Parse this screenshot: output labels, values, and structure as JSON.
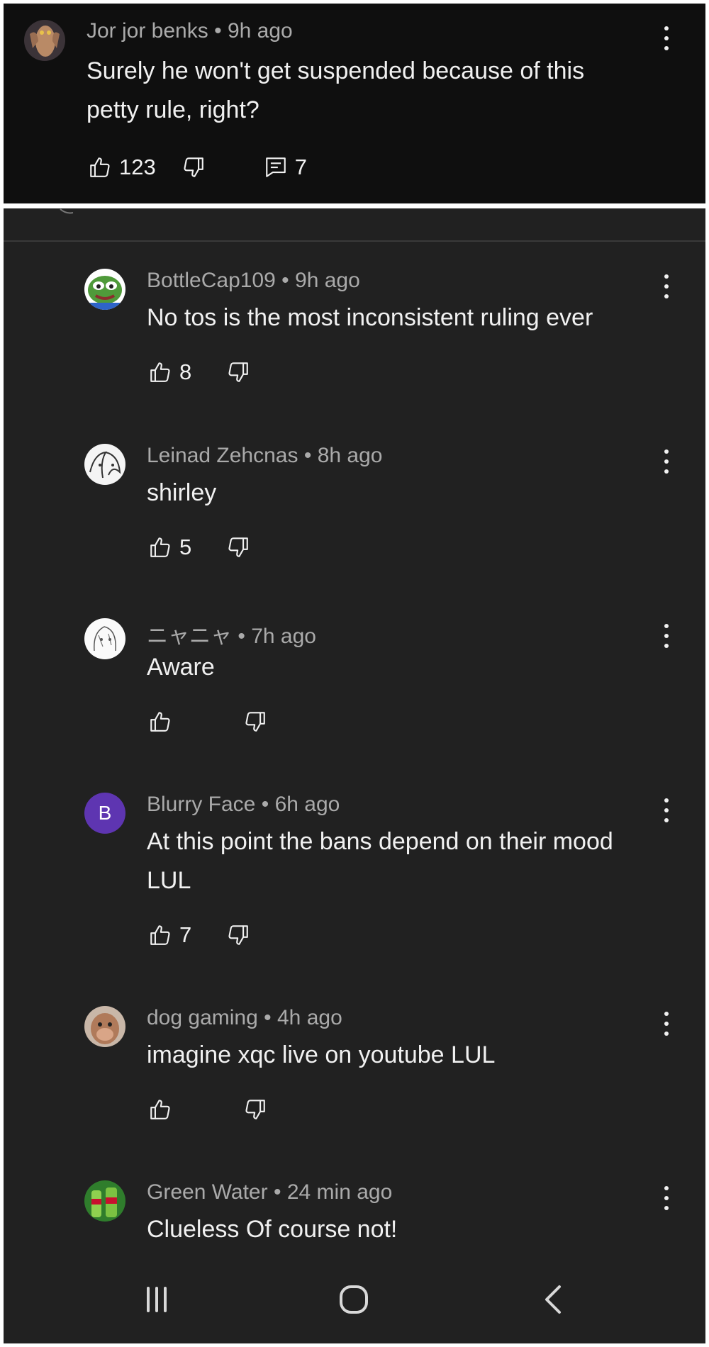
{
  "comments": [
    {
      "author": "Jor jor benks",
      "time": "9h ago",
      "text_lines": [
        "Surely he won't get suspended because of this",
        "petty rule, right?"
      ],
      "likes": "123",
      "replies": "7",
      "avatar": "jarjar-avatar"
    },
    {
      "author": "BottleCap109",
      "time": "9h ago",
      "text_lines": [
        "No tos is the most inconsistent ruling ever"
      ],
      "likes": "8",
      "avatar": "pepe-avatar"
    },
    {
      "author": "Leinad Zehcnas",
      "time": "8h ago",
      "text_lines": [
        "shirley"
      ],
      "likes": "5",
      "avatar": "sketch-avatar"
    },
    {
      "author": "ニャニャ",
      "time": "7h ago",
      "text_lines": [
        "Aware"
      ],
      "likes": "",
      "avatar": "lineart-avatar"
    },
    {
      "author": "Blurry Face",
      "time": "6h ago",
      "text_lines": [
        "At this point the bans depend on their mood",
        "LUL"
      ],
      "likes": "7",
      "avatar_letter": "B",
      "avatar_color": "#5e35b1"
    },
    {
      "author": "dog gaming",
      "time": "4h ago",
      "text_lines": [
        "imagine xqc live on youtube LUL"
      ],
      "likes": "",
      "avatar": "monkey-avatar"
    },
    {
      "author": "Green Water",
      "time": "24 min ago",
      "text_lines": [
        "Clueless Of course not!"
      ],
      "likes": "",
      "avatar": "mountain-dew-avatar"
    }
  ],
  "separator": "•",
  "colors": {
    "background": "#212121",
    "top_background": "#0f0f0f",
    "meta": "#aaaaaa",
    "text": "#f1f1f1"
  },
  "navbar": {
    "recent_icon": "recent-apps-icon",
    "home_icon": "home-icon",
    "back_icon": "back-icon"
  }
}
